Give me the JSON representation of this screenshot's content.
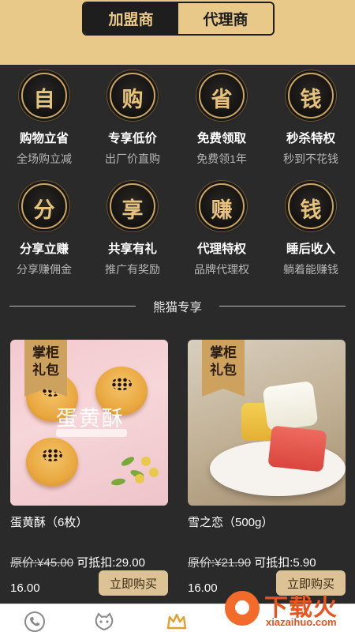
{
  "header": {
    "tabs": [
      {
        "label": "加盟商",
        "active": true
      },
      {
        "label": "代理商",
        "active": false
      }
    ]
  },
  "benefits": [
    {
      "glyph": "自",
      "title": "购物立省",
      "subtitle": "全场购立减"
    },
    {
      "glyph": "购",
      "title": "专享低价",
      "subtitle": "出厂价直购"
    },
    {
      "glyph": "省",
      "title": "免费领取",
      "subtitle": "免费领1年"
    },
    {
      "glyph": "钱",
      "title": "秒杀特权",
      "subtitle": "秒到不花钱"
    },
    {
      "glyph": "分",
      "title": "分享立赚",
      "subtitle": "分享赚佣金"
    },
    {
      "glyph": "享",
      "title": "共享有礼",
      "subtitle": "推广有奖励"
    },
    {
      "glyph": "赚",
      "title": "代理特权",
      "subtitle": "品牌代理权"
    },
    {
      "glyph": "钱",
      "title": "睡后收入",
      "subtitle": "躺着能赚钱"
    }
  ],
  "section": {
    "title": "熊猫专享"
  },
  "products": [
    {
      "tag": "掌柜礼包",
      "tag_line1": "掌柜",
      "tag_line2": "礼包",
      "image_text": "蛋黄酥",
      "name": "蛋黄酥（6枚）",
      "original_price": "原价:¥45.00",
      "deduct": "可抵扣:29.00",
      "final_price": "16.00",
      "button": "立即购买"
    },
    {
      "tag": "掌柜礼包",
      "tag_line1": "掌柜",
      "tag_line2": "礼包",
      "name": "雪之恋（500g）",
      "original_price": "原价:¥21.90",
      "deduct": "可抵扣:5.90",
      "final_price": "16.00",
      "button": "立即购买"
    }
  ],
  "watermark": {
    "text": "下载火",
    "url": "xiazaihuo.com"
  },
  "colors": {
    "gold": "#e8c98a",
    "dark": "#2a2a2a",
    "accent_orange": "#e8541e"
  },
  "bottom_nav": {
    "icons": [
      "phone-icon",
      "smile-icon",
      "crown-icon"
    ]
  }
}
